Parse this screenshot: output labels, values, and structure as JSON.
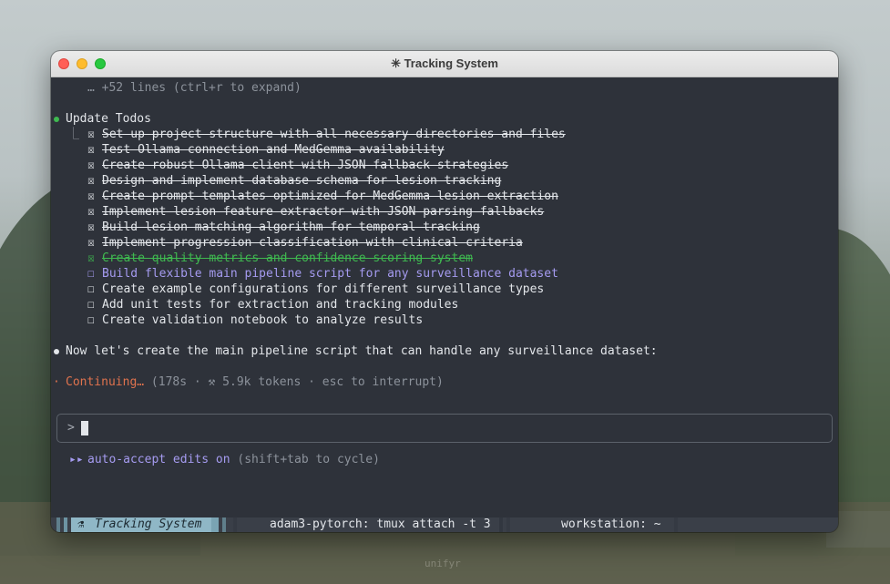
{
  "window": {
    "title": "✳ Tracking System"
  },
  "terminal": {
    "collapsed_line": "… +52 lines (ctrl+r to expand)",
    "todos_header": "Update Todos",
    "todos": [
      {
        "label": "Set up project structure with all necessary directories and files",
        "state": "done"
      },
      {
        "label": "Test Ollama connection and MedGemma availability",
        "state": "done"
      },
      {
        "label": "Create robust Ollama client with JSON fallback strategies",
        "state": "done"
      },
      {
        "label": "Design and implement database schema for lesion tracking",
        "state": "done"
      },
      {
        "label": "Create prompt templates optimized for MedGemma lesion extraction",
        "state": "done"
      },
      {
        "label": "Implement lesion feature extractor with JSON parsing fallbacks",
        "state": "done"
      },
      {
        "label": "Build lesion matching algorithm for temporal tracking",
        "state": "done"
      },
      {
        "label": "Implement progression classification with clinical criteria",
        "state": "done"
      },
      {
        "label": "Create quality metrics and confidence scoring system",
        "state": "just_done"
      },
      {
        "label": "Build flexible main pipeline script for any surveillance dataset",
        "state": "in_progress"
      },
      {
        "label": "Create example configurations for different surveillance types",
        "state": "pending"
      },
      {
        "label": "Add unit tests for extraction and tracking modules",
        "state": "pending"
      },
      {
        "label": "Create validation notebook to analyze results",
        "state": "pending"
      }
    ],
    "message": "Now let's create the main pipeline script that can handle any surveillance dataset:",
    "status_word": "Continuing…",
    "status_detail": " (178s · ⚒ 5.9k tokens · esc to interrupt)",
    "prompt_symbol": ">",
    "input_value": "",
    "mode_label": "auto-accept edits on",
    "mode_hint": " (shift+tab to cycle)"
  },
  "tmux": {
    "session_name": "Tracking System",
    "window_2": "adam3-pytorch: tmux attach -t 3",
    "window_3": "workstation: ~"
  },
  "desktop": {
    "watermark": "unifyr"
  },
  "colors": {
    "green": "#3fb950",
    "purple": "#a59bf0",
    "orange": "#e0734e",
    "terminal_bg": "#2e323a"
  }
}
